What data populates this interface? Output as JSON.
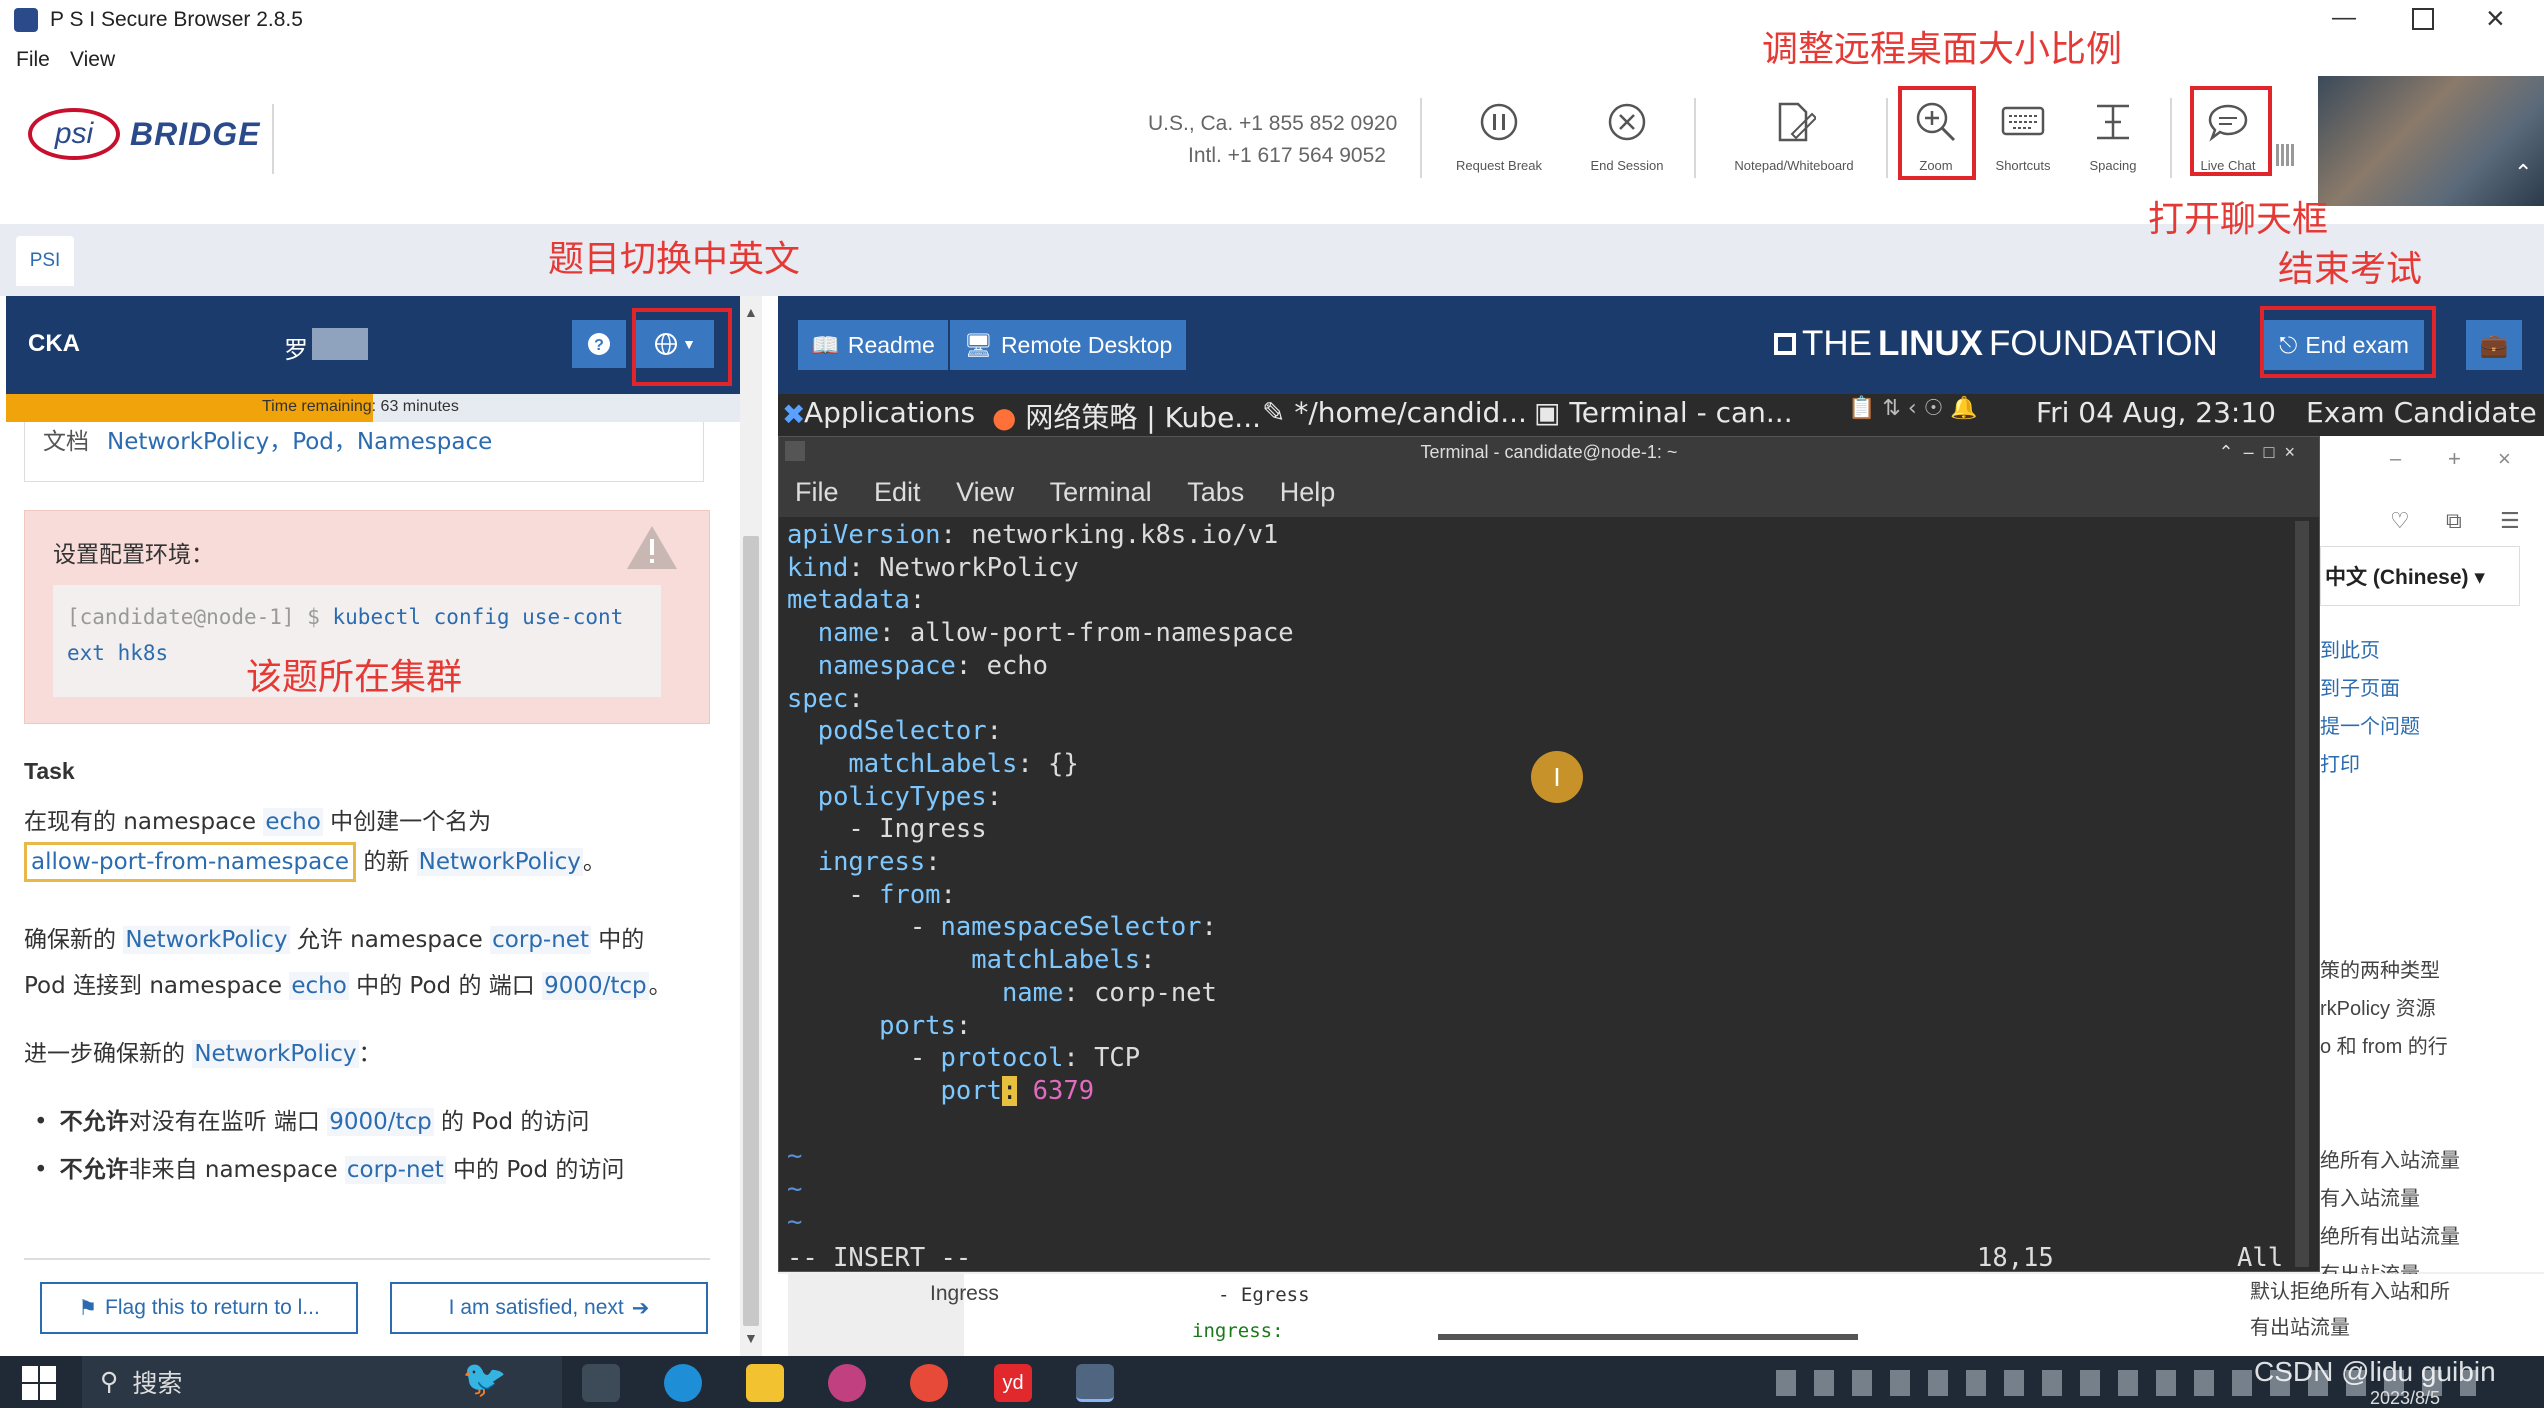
{
  "window": {
    "title": "P S I Secure Browser 2.8.5"
  },
  "menu": {
    "file": "File",
    "view": "View"
  },
  "brand": {
    "psi": "psi",
    "bridge": "BRIDGE"
  },
  "contact": {
    "us": "U.S., Ca.  +1 855 852 0920",
    "intl": "Intl.  +1 617 564 9052"
  },
  "toolbar": {
    "request_break": "Request Break",
    "end_session": "End Session",
    "notepad": "Notepad/Whiteboard",
    "zoom": "Zoom",
    "shortcuts": "Shortcuts",
    "spacing": "Spacing",
    "live_chat": "Live Chat"
  },
  "annotations": {
    "zoom": "调整远程桌面大小比例",
    "chat": "打开聊天框",
    "end": "结束考试",
    "lang": "题目切换中英文",
    "cluster": "该题所在集群"
  },
  "tab": {
    "label": "PSI"
  },
  "left": {
    "exam": "CKA",
    "user": "罗",
    "timer": "Time remaining: 63 minutes",
    "timer_fraction": 0.5,
    "docs_label": "文档",
    "docs_links": "NetworkPolicy，Pod，Namespace",
    "env_title": "设置配置环境：",
    "cmd_prompt": "[candidate@node-1] $ ",
    "cmd_a": "kubectl config use-cont",
    "cmd_b": "ext hk8s",
    "task_heading": "Task",
    "task_l1a": "在现有的 namespace ",
    "task_l1b": "echo",
    "task_l1c": " 中创建一个名为",
    "task_l2a": "allow-port-from-namespace",
    "task_l2b": " 的新 ",
    "task_l2c": "NetworkPolicy",
    "task_l2d": "。",
    "p2_l1a": "确保新的 ",
    "p2_l1b": "NetworkPolicy",
    "p2_l1c": " 允许 namespace ",
    "p2_l1d": "corp-net",
    "p2_l1e": " 中的",
    "p2_l2a": "Pod 连接到 namespace ",
    "p2_l2b": "echo",
    "p2_l2c": " 中的 Pod 的 端口 ",
    "p2_l2d": "9000/tcp",
    "p2_l2e": "。",
    "p3a": "进一步确保新的 ",
    "p3b": "NetworkPolicy",
    "p3c": "：",
    "b1a": "不允许",
    "b1b": "对没有在监听 端口 ",
    "b1c": "9000/tcp",
    "b1d": " 的 Pod 的访问",
    "b2a": "不允许",
    "b2b": "非来自 namespace ",
    "b2c": "corp-net",
    "b2d": " 中的 Pod 的访问",
    "flag_btn": "Flag this to return to l...",
    "next_btn": "I am satisfied, next"
  },
  "right": {
    "readme": "Readme",
    "remote": "Remote Desktop",
    "lf_the": "THE",
    "lf_linux": "LINUX",
    "lf_foundation": "FOUNDATION",
    "end_exam": "End exam"
  },
  "desktop": {
    "applications": "Applications",
    "task1": "网络策略 | Kube...",
    "task2": "*/home/candid...",
    "task3": "Terminal - can...",
    "clock": "Fri 04 Aug, 23:10",
    "user": "Exam Candidate",
    "term_title": "Terminal - candidate@node-1: ~",
    "term_menu": [
      "File",
      "Edit",
      "View",
      "Terminal",
      "Tabs",
      "Help"
    ],
    "vim_mode": "-- INSERT --",
    "vim_pos": "18,15",
    "vim_all": "All",
    "side_lang": "中文 (Chinese)",
    "side_links": [
      "到此页",
      "到子页面",
      "提一个问题",
      "打印"
    ],
    "side_texts": [
      "策的两种类型",
      "rkPolicy 资源",
      "o 和 from 的行",
      "绝所有入站流量",
      "有入站流量",
      "绝所有出站流量",
      "有出站流量",
      "默认拒绝所有入站和所",
      "有出站流量"
    ],
    "doc_ingress": "Ingress",
    "doc_egress": "- Egress",
    "doc_ingress2": "ingress:"
  },
  "taskbar": {
    "search": "搜索",
    "watermark": "CSDN @lidu guibin",
    "date": "2023/8/5"
  }
}
